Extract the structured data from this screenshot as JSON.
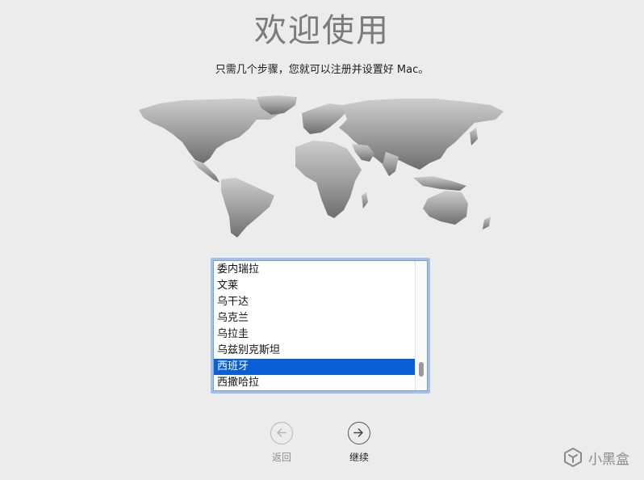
{
  "header": {
    "title": "欢迎使用",
    "subtitle": "只需几个步骤，您就可以注册并设置好 Mac。"
  },
  "country_list": {
    "items": [
      {
        "label": "委内瑞拉",
        "selected": false
      },
      {
        "label": "文莱",
        "selected": false
      },
      {
        "label": "乌干达",
        "selected": false
      },
      {
        "label": "乌克兰",
        "selected": false
      },
      {
        "label": "乌拉圭",
        "selected": false
      },
      {
        "label": "乌兹别克斯坦",
        "selected": false
      },
      {
        "label": "西班牙",
        "selected": true
      },
      {
        "label": "西撒哈拉",
        "selected": false
      }
    ],
    "selection_color": "#0a5fd6"
  },
  "navigation": {
    "back_label": "返回",
    "back_icon": "arrow-left-circle-icon",
    "continue_label": "继续",
    "continue_icon": "arrow-right-circle-icon"
  },
  "watermark": {
    "text": "小黑盒"
  }
}
